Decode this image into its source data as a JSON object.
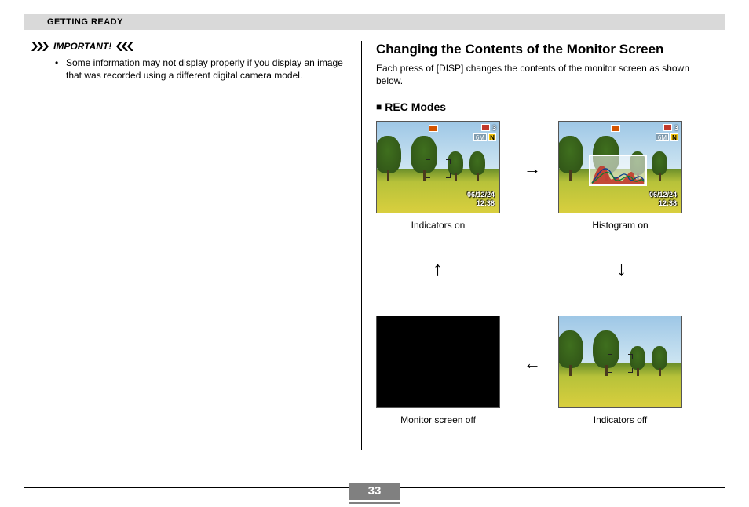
{
  "section_header": "GETTING READY",
  "left": {
    "important_label": "IMPORTANT!",
    "bullet": "Some information may not display properly if you display an image that was recorded using a different digital camera model."
  },
  "right": {
    "heading": "Changing the Contents of the Monitor Screen",
    "body": "Each press of [DISP] changes the contents of the monitor screen as shown below.",
    "subheading": "REC Modes",
    "thumbs": {
      "t1": {
        "caption": "Indicators on"
      },
      "t2": {
        "caption": "Histogram on"
      },
      "t3": {
        "caption": "Monitor screen off"
      },
      "t4": {
        "caption": "Indicators off"
      }
    },
    "overlay": {
      "count": "3",
      "size_label": "6M",
      "quality_label": "N",
      "date": "06/12/24",
      "time": "12:38"
    }
  },
  "page_number": "33"
}
